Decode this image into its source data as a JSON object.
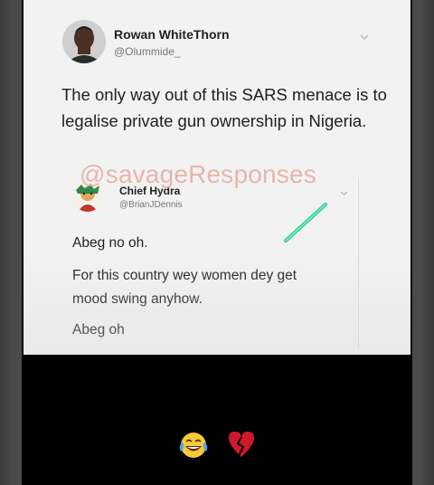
{
  "tweet": {
    "author_name": "Rowan WhiteThorn",
    "author_handle": "@Olummide_",
    "text": "The only way out of this SARS menace is to legalise private gun ownership in Nigeria."
  },
  "watermark": "@savageResponses",
  "quoted_tweet": {
    "author_name": "Chief Hydra",
    "author_handle": "@BrianJDennis",
    "lines": [
      "Abeg no oh.",
      "For this country wey women dey get",
      "mood swing anyhow.",
      "Abeg oh"
    ]
  },
  "reaction_icons": [
    "face-with-tears-of-joy-icon",
    "broken-heart-icon"
  ],
  "colors": {
    "card_bg": "#f2f2f2",
    "page_bg": "#000000",
    "side_bars": "#4a4a4a",
    "marker_green": "#2ecc8f",
    "watermark": "#e5b0a3",
    "broken_heart": "#d0182c",
    "emoji_yellow": "#f8c93a"
  }
}
